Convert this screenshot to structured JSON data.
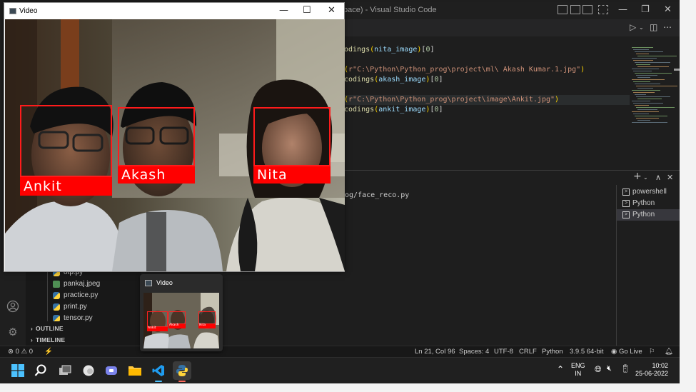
{
  "vscode": {
    "window_title": "pace) - Visual Studio Code",
    "code_lines": [
      {
        "segments": [
          {
            "t": "odings",
            "c": "fn"
          },
          {
            "t": "(",
            "c": "br"
          },
          {
            "t": "nita_image",
            "c": "var"
          },
          {
            "t": ")",
            "c": "br"
          },
          {
            "t": "[",
            "c": "punc"
          },
          {
            "t": "0",
            "c": "num"
          },
          {
            "t": "]",
            "c": "punc"
          }
        ]
      },
      {
        "segments": []
      },
      {
        "segments": [
          {
            "t": "(",
            "c": "br"
          },
          {
            "t": "r\"C:\\Python\\Python_prog\\project\\ml\\ Akash Kumar.1.jpg\"",
            "c": "str"
          },
          {
            "t": ")",
            "c": "br"
          }
        ]
      },
      {
        "segments": [
          {
            "t": "codings",
            "c": "fn"
          },
          {
            "t": "(",
            "c": "br"
          },
          {
            "t": "akash_image",
            "c": "var"
          },
          {
            "t": ")",
            "c": "br"
          },
          {
            "t": "[",
            "c": "punc"
          },
          {
            "t": "0",
            "c": "num"
          },
          {
            "t": "]",
            "c": "punc"
          }
        ]
      },
      {
        "segments": []
      },
      {
        "segments": [
          {
            "t": "(",
            "c": "br"
          },
          {
            "t": "r\"C:\\Python\\Python_prog\\project\\image\\Ankit.jpg\"",
            "c": "str"
          },
          {
            "t": ")",
            "c": "br"
          }
        ],
        "highlight": true
      },
      {
        "segments": [
          {
            "t": "codings",
            "c": "fn"
          },
          {
            "t": "(",
            "c": "br"
          },
          {
            "t": "ankit_image",
            "c": "var"
          },
          {
            "t": ")",
            "c": "br"
          },
          {
            "t": "[",
            "c": "punc"
          },
          {
            "t": "0",
            "c": "num"
          },
          {
            "t": "]",
            "c": "punc"
          }
        ]
      }
    ],
    "terminal_text": "og/face_reco.py",
    "terminals": [
      "powershell",
      "Python",
      "Python"
    ],
    "files": [
      "otp.py",
      "pankaj.jpeg",
      "practice.py",
      "print.py",
      "tensor.py"
    ],
    "sections": [
      "OUTLINE",
      "TIMELINE"
    ],
    "status": {
      "errors": "0",
      "warnings": "0",
      "position": "Ln 21, Col 96",
      "spaces": "Spaces: 4",
      "encoding": "UTF-8",
      "eol": "CRLF",
      "language": "Python",
      "interpreter": "3.9.5 64-bit",
      "golive": "Go Live"
    }
  },
  "video_window": {
    "title": "Video",
    "faces": [
      "Ankit",
      "Akash",
      "Nita"
    ]
  },
  "thumbnail": {
    "title": "Video",
    "faces": [
      "Ankit",
      "Akash",
      "Nita"
    ]
  },
  "taskbar": {
    "lang_top": "ENG",
    "lang_bottom": "IN",
    "time": "10:02",
    "date": "25-06-2022"
  },
  "colors": {
    "box_red": "#ff0000",
    "vscode_bg": "#1e1e1e",
    "taskbar_bg": "#202020"
  }
}
